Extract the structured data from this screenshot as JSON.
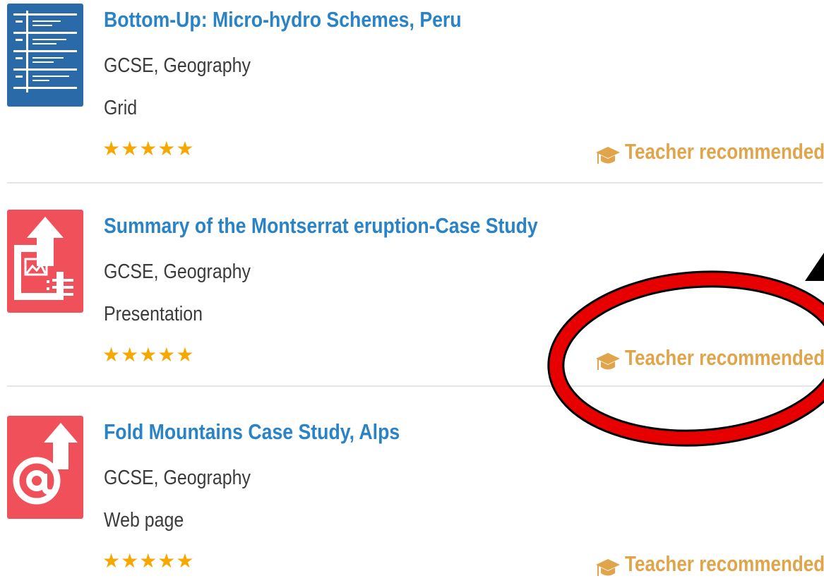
{
  "colors": {
    "title": "#2a83c6",
    "star": "#f6a800",
    "recommend": "#e0a54a",
    "annotation_ellipse": "#e60000",
    "thumb_blue": "#2a6aa9",
    "thumb_red": "#f0505a"
  },
  "resources": [
    {
      "title": "Bottom-Up: Micro-hydro Schemes, Peru",
      "subject": "GCSE, Geography",
      "type": "Grid",
      "stars": "★★★★★",
      "rating": 5,
      "recommend_label": "Teacher recommended",
      "icon": "grid-document-icon"
    },
    {
      "title": "Summary of the Montserrat eruption-Case Study",
      "subject": "GCSE, Geography",
      "type": "Presentation",
      "stars": "★★★★★",
      "rating": 5,
      "recommend_label": "Teacher recommended",
      "icon": "presentation-upload-icon"
    },
    {
      "title": "Fold Mountains Case Study, Alps",
      "subject": "GCSE, Geography",
      "type": "Web page",
      "stars": "★★★★★",
      "rating": 5,
      "recommend_label": "Teacher recommended",
      "icon": "web-link-upload-icon"
    }
  ],
  "annotation": {
    "shape": "ellipse",
    "arrow": "arrow-pointing-up-right",
    "highlights": "Teacher recommended"
  }
}
